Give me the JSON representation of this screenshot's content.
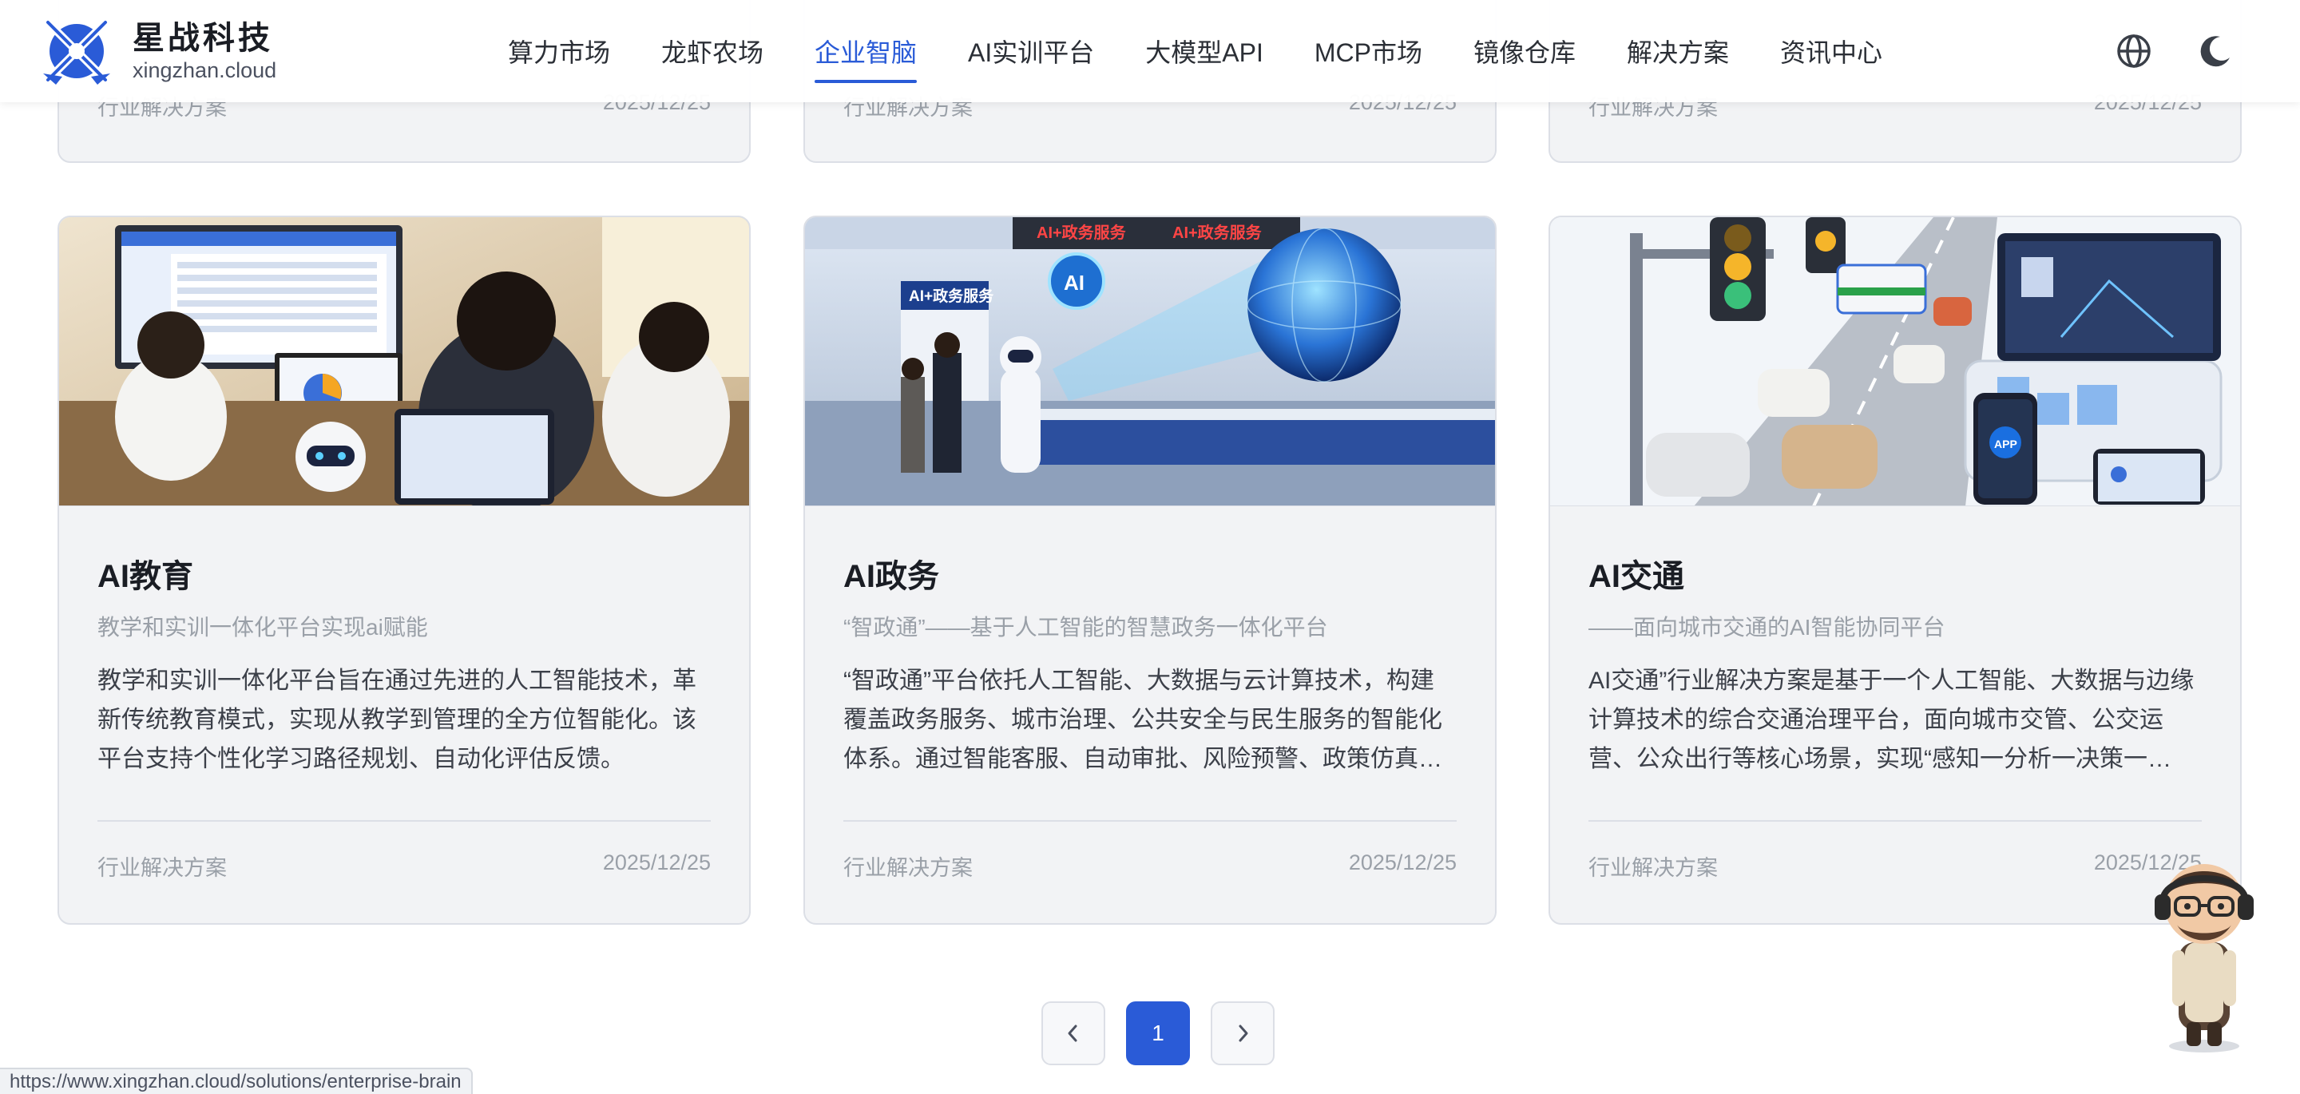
{
  "header": {
    "logo_name": "星战科技",
    "logo_domain": "xingzhan.cloud",
    "nav": [
      {
        "label": "算力市场",
        "active": false
      },
      {
        "label": "龙虾农场",
        "active": false
      },
      {
        "label": "企业智脑",
        "active": true
      },
      {
        "label": "AI实训平台",
        "active": false
      },
      {
        "label": "大模型API",
        "active": false
      },
      {
        "label": "MCP市场",
        "active": false
      },
      {
        "label": "镜像仓库",
        "active": false
      },
      {
        "label": "解决方案",
        "active": false
      },
      {
        "label": "资讯中心",
        "active": false
      }
    ],
    "icons": [
      "globe-icon",
      "moon-icon"
    ]
  },
  "top_cards": [
    {
      "category": "行业解决方案",
      "date": "2025/12/25"
    },
    {
      "category": "行业解决方案",
      "date": "2025/12/25"
    },
    {
      "category": "行业解决方案",
      "date": "2025/12/25"
    }
  ],
  "cards": [
    {
      "title": "AI教育",
      "subtitle": "教学和实训一体化平台实现ai赋能",
      "description": "教学和实训一体化平台旨在通过先进的人工智能技术，革新传统教育模式，实现从教学到管理的全方位智能化。该平台支持个性化学习路径规划、自动化评估反馈。",
      "category": "行业解决方案",
      "date": "2025/12/25"
    },
    {
      "title": "AI政务",
      "subtitle": "“智政通”——基于人工智能的智慧政务一体化平台",
      "description": "“智政通”平台依托人工智能、大数据与云计算技术，构建覆盖政务服务、城市治理、公共安全与民生服务的智能化体系。通过智能客服、自动审批、风险预警、政策仿真…",
      "category": "行业解决方案",
      "date": "2025/12/25"
    },
    {
      "title": "AI交通",
      "subtitle": "——面向城市交通的AI智能协同平台",
      "description": "AI交通”行业解决方案是基于一个人工智能、大数据与边缘计算技术的综合交通治理平台，面向城市交管、公交运营、公众出行等核心场景，实现“感知一分析一决策一…",
      "category": "行业解决方案",
      "date": "2025/12/25"
    }
  ],
  "image_labels": {
    "gov_sign": "AI+政务服务",
    "gov_banner": "AI+政务服务",
    "gov_globe": "AI",
    "traffic_phone": "APP"
  },
  "pagination": {
    "prev": "‹",
    "current": "1",
    "next": "›"
  },
  "status_url": "https://www.xingzhan.cloud/solutions/enterprise-brain",
  "colors": {
    "accent": "#2a5bd7",
    "card_bg": "#f2f3f5",
    "muted": "#9aa0a8"
  }
}
